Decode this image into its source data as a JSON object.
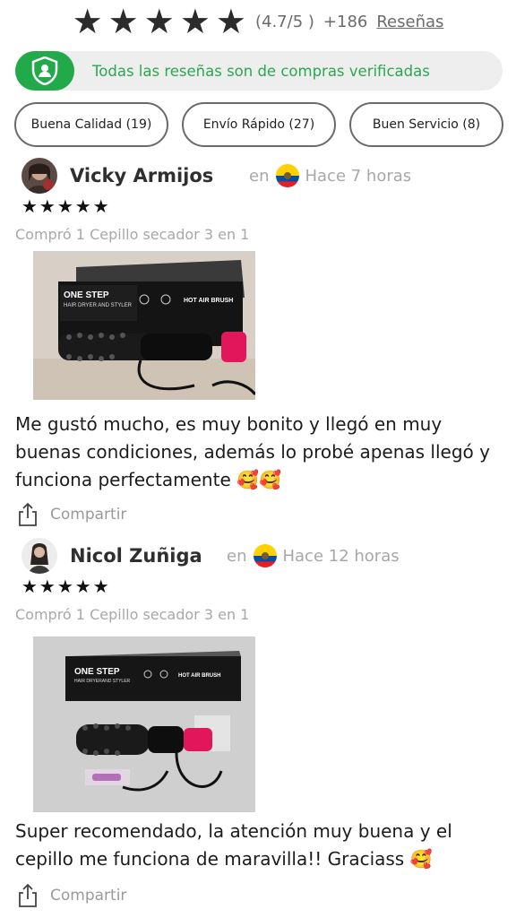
{
  "summary": {
    "stars": [
      "★",
      "★",
      "★",
      "★",
      "★"
    ],
    "rating": "(4.7/5 )",
    "count": "+186",
    "reviews_link": "Reseñas"
  },
  "verified": {
    "text": "Todas las reseñas son de compras verificadas",
    "icon": "shield-user-icon",
    "color": "#22a94a"
  },
  "filters": [
    {
      "label": "Buena Calidad (19)"
    },
    {
      "label": "Envío Rápido (27)"
    },
    {
      "label": "Buen Servicio (8)"
    }
  ],
  "reviews": [
    {
      "name": "Vicky Armijos",
      "location_prefix": "en",
      "flag": "ecuador-flag",
      "time": "Hace 7 horas",
      "stars": "★★★★★",
      "purchase": "Compró 1 Cepillo secador 3 en 1",
      "photo": {
        "box_title": "ONE STEP",
        "box_subtitle": "HAIR DRYER AND STYLER",
        "box_label": "HOT AIR BRUSH"
      },
      "text": "Me gustó mucho, es muy bonito y llegó en muy buenas condiciones, además lo probé apenas llegó y funciona perfectamente 🥰🥰",
      "share": "Compartir"
    },
    {
      "name": "Nicol Zuñiga",
      "location_prefix": "en",
      "flag": "ecuador-flag",
      "time": "Hace 12 horas",
      "stars": "★★★★★",
      "purchase": "Compró 1 Cepillo secador 3 en 1",
      "photo": {
        "box_title": "ONE STEP",
        "box_subtitle": "HAIR DRYERAND STYLER",
        "box_label": "HOT AIR BRUSH"
      },
      "text": "Super recomendado, la atención muy buena y el cepillo me funciona de maravilla!! Graciass 🥰",
      "share": "Compartir"
    }
  ]
}
